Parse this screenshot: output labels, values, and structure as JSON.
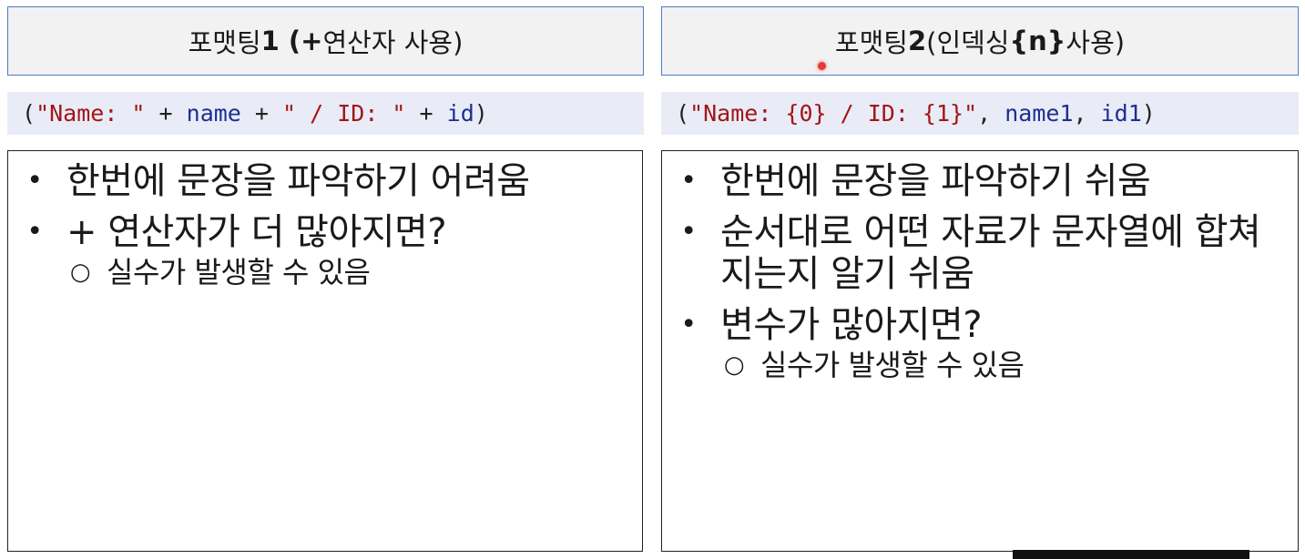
{
  "left": {
    "title_prefix": "포맷팅 ",
    "title_bold": "1 (+",
    "title_suffix": " 연산자 사용)",
    "code": [
      {
        "text": "(",
        "cls": ""
      },
      {
        "text": "\"Name: \"",
        "cls": "str"
      },
      {
        "text": " + ",
        "cls": ""
      },
      {
        "text": "name",
        "cls": "var"
      },
      {
        "text": " + ",
        "cls": ""
      },
      {
        "text": "\" / ID: \"",
        "cls": "str"
      },
      {
        "text": " + ",
        "cls": ""
      },
      {
        "text": "id",
        "cls": "var"
      },
      {
        "text": ")",
        "cls": ""
      }
    ],
    "bullets": [
      {
        "text": "한번에 문장을 파악하기 어려움",
        "sub": []
      },
      {
        "text": "+ 연산자가 더 많아지면?",
        "sub": [
          "실수가 발생할 수 있음"
        ]
      }
    ]
  },
  "right": {
    "title_prefix": "포맷팅 ",
    "title_bold": "2",
    "title_middle": "(인덱싱",
    "title_bold2": "{n}",
    "title_suffix": " 사용)",
    "code": [
      {
        "text": "(",
        "cls": ""
      },
      {
        "text": "\"Name: {0} / ID: {1}\"",
        "cls": "str"
      },
      {
        "text": ", ",
        "cls": ""
      },
      {
        "text": "name1",
        "cls": "var"
      },
      {
        "text": ", ",
        "cls": ""
      },
      {
        "text": "id1",
        "cls": "var"
      },
      {
        "text": ")",
        "cls": ""
      }
    ],
    "bullets": [
      {
        "text": "한번에 문장을 파악하기 쉬움",
        "sub": []
      },
      {
        "text": "순서대로 어떤 자료가 문자열에 합쳐지는지 알기 쉬움",
        "sub": []
      },
      {
        "text": "변수가 많아지면?",
        "sub": [
          "실수가 발생할 수 있음"
        ]
      }
    ]
  },
  "bullet_glyph": "•",
  "sub_bullet_glyph": "○"
}
